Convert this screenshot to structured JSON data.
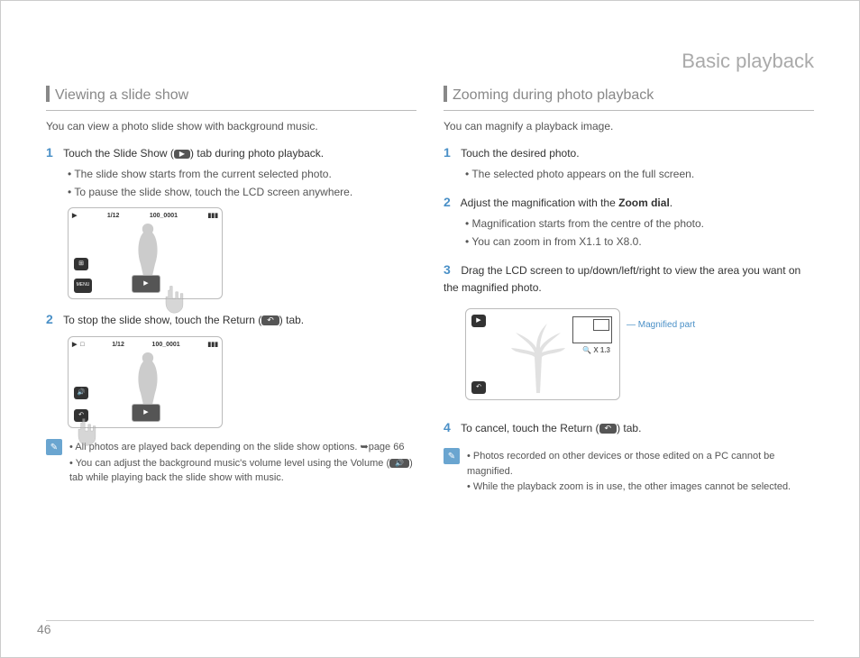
{
  "chapter": "Basic playback",
  "page_number": "46",
  "left": {
    "heading": "Viewing a slide show",
    "intro": "You can view a photo slide show with background music.",
    "step1_pre": "Touch the Slide Show (",
    "step1_post": ") tab during photo playback.",
    "step1_sub1": "The slide show starts from the current selected photo.",
    "step1_sub2": "To pause the slide show, touch the LCD screen anywhere.",
    "screen_counter": "1/12",
    "screen_file": "100_0001",
    "screen_menu": "MENU",
    "step2_pre": "To stop the slide show, touch the Return (",
    "step2_post": ") tab.",
    "note1": "All photos are played back depending on the slide show options. ",
    "note1_ref": "➥page 66",
    "note2_pre": "You can adjust the background music's volume level using the Volume (",
    "note2_post": ") tab while playing back the slide show with music.",
    "slideshow_icon": "▶",
    "return_icon": "↶",
    "volume_icon": "🔊"
  },
  "right": {
    "heading": "Zooming during photo playback",
    "intro": "You can magnify a playback image.",
    "step1": "Touch the desired photo.",
    "step1_sub1": "The selected photo appears on the full screen.",
    "step2_pre": "Adjust the magnification with the ",
    "step2_bold": "Zoom dial",
    "step2_post": ".",
    "step2_sub1": "Magnification starts from the centre of the photo.",
    "step2_sub2": "You can zoom in from X1.1 to X8.0.",
    "step3": "Drag the LCD screen to up/down/left/right to view the area you want on the magnified photo.",
    "zoom_label": "X 1.3",
    "callout": "Magnified part",
    "step4_pre": "To cancel, touch the Return (",
    "step4_post": ") tab.",
    "note1": "Photos recorded on other devices or those edited on a PC cannot be magnified.",
    "note2": "While the playback zoom is in use, the other images cannot be selected."
  }
}
